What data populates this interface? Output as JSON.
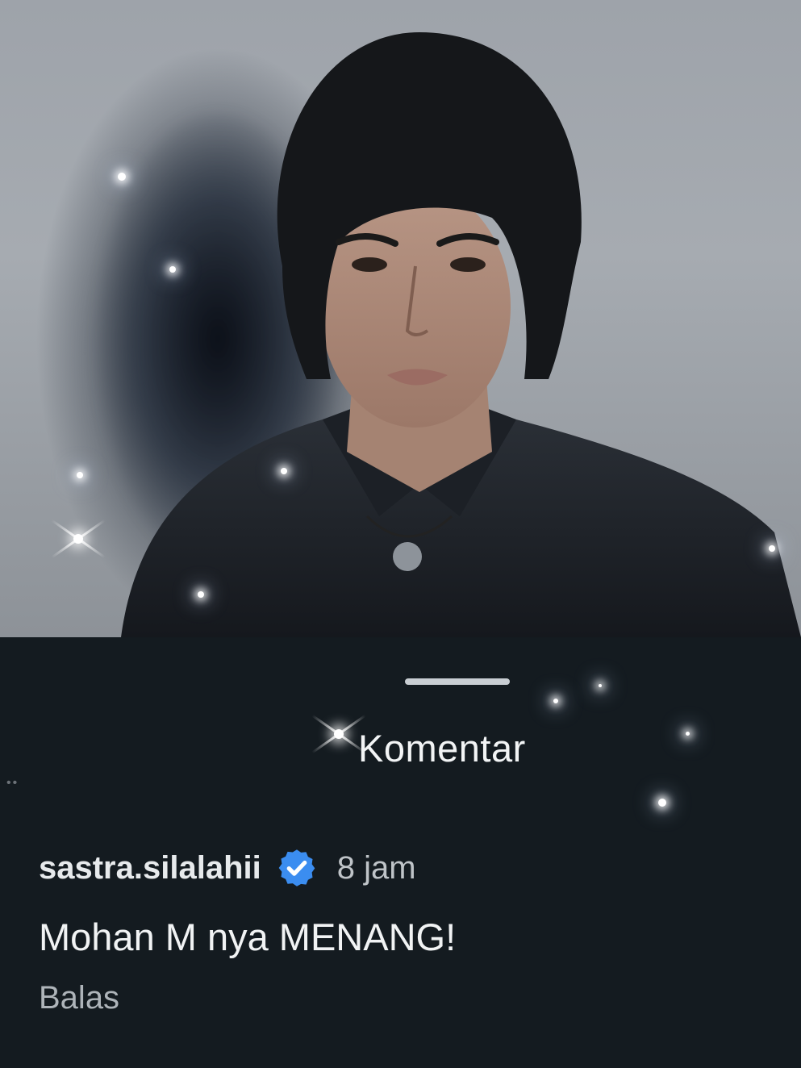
{
  "post": {
    "image_alt_icon": "portrait-photo"
  },
  "comments_sheet": {
    "title": "Komentar"
  },
  "comment": {
    "username": "sastra.silalahii",
    "verified": true,
    "verified_icon": "verified-badge-icon",
    "verified_color": "#3b8df0",
    "time": "8 jam",
    "text": "Mohan M nya MENANG!",
    "reply_label": "Balas"
  },
  "colors": {
    "sheet_background": "#141b20",
    "text_primary": "#f1f3f4",
    "text_secondary": "#bfc4c8"
  }
}
